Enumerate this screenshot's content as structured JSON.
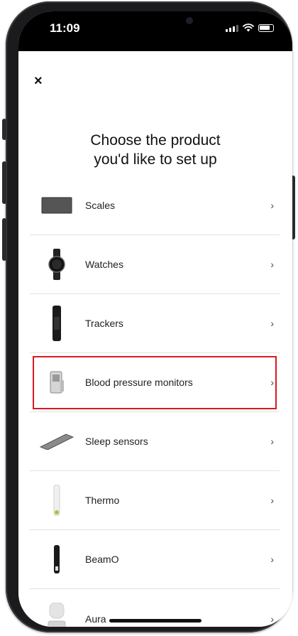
{
  "status_bar": {
    "time": "11:09"
  },
  "page": {
    "close_glyph": "×",
    "title_line1": "Choose the product",
    "title_line2": "you'd like to set up"
  },
  "products": [
    {
      "label": "Scales",
      "icon": "scale-icon",
      "chevron": "›"
    },
    {
      "label": "Watches",
      "icon": "watch-icon",
      "chevron": "›"
    },
    {
      "label": "Trackers",
      "icon": "tracker-icon",
      "chevron": "›"
    },
    {
      "label": "Blood pressure monitors",
      "icon": "blood-pressure-monitor-icon",
      "chevron": "›",
      "highlighted": true
    },
    {
      "label": "Sleep sensors",
      "icon": "sleep-sensor-icon",
      "chevron": "›"
    },
    {
      "label": "Thermo",
      "icon": "thermometer-icon",
      "chevron": "›"
    },
    {
      "label": "BeamO",
      "icon": "beamo-icon",
      "chevron": "›"
    },
    {
      "label": "Aura",
      "icon": "aura-icon",
      "chevron": "›"
    }
  ],
  "colors": {
    "highlight": "#d71920",
    "text": "#111111",
    "divider": "#e2e2e2"
  }
}
